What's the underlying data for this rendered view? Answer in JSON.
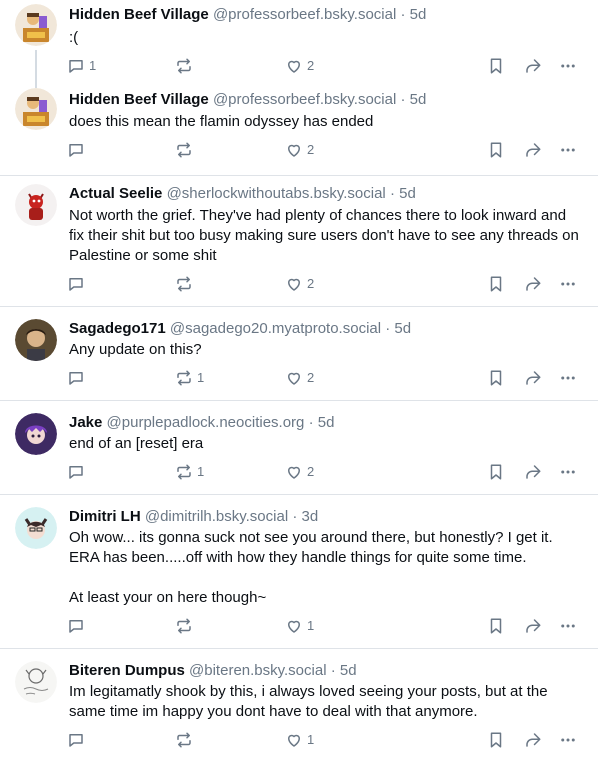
{
  "posts": [
    {
      "author": "Hidden Beef Village",
      "handle": "@professorbeef.bsky.social",
      "time": "5d",
      "text": [
        ":("
      ],
      "replies": "1",
      "reposts": "",
      "likes": "2"
    },
    {
      "author": "Hidden Beef Village",
      "handle": "@professorbeef.bsky.social",
      "time": "5d",
      "text": [
        "does this mean the flamin odyssey has ended"
      ],
      "replies": "",
      "reposts": "",
      "likes": "2"
    },
    {
      "author": "Actual Seelie",
      "handle": "@sherlockwithoutabs.bsky.social",
      "time": "5d",
      "text": [
        "Not worth the grief. They've had plenty of chances there to look inward and fix their shit but too busy making sure users don't have to see any threads on Palestine or some shit"
      ],
      "replies": "",
      "reposts": "",
      "likes": "2"
    },
    {
      "author": "Sagadego171",
      "handle": "@sagadego20.myatproto.social",
      "time": "5d",
      "text": [
        "Any update on this?"
      ],
      "replies": "",
      "reposts": "1",
      "likes": "2"
    },
    {
      "author": "Jake",
      "handle": "@purplepadlock.neocities.org",
      "time": "5d",
      "text": [
        "end of an [reset] era"
      ],
      "replies": "",
      "reposts": "1",
      "likes": "2"
    },
    {
      "author": "Dimitri LH",
      "handle": "@dimitrilh.bsky.social",
      "time": "3d",
      "text": [
        "Oh wow... its gonna suck not see you around there, but honestly? I get it. ERA has been.....off with how they handle things for quite some time.",
        "",
        "At least your on here though~"
      ],
      "replies": "",
      "reposts": "",
      "likes": "1"
    },
    {
      "author": "Biteren Dumpus",
      "handle": "@biteren.bsky.social",
      "time": "5d",
      "text": [
        "Im legitamatly shook by this, i always loved seeing your posts, but at the same time im happy you dont have to deal with that anymore."
      ],
      "replies": "",
      "reposts": "",
      "likes": "1"
    }
  ],
  "separator": "·",
  "colors": {
    "text": "#0b0f14",
    "muted": "#6a7785",
    "divider": "#dfe3e8"
  }
}
